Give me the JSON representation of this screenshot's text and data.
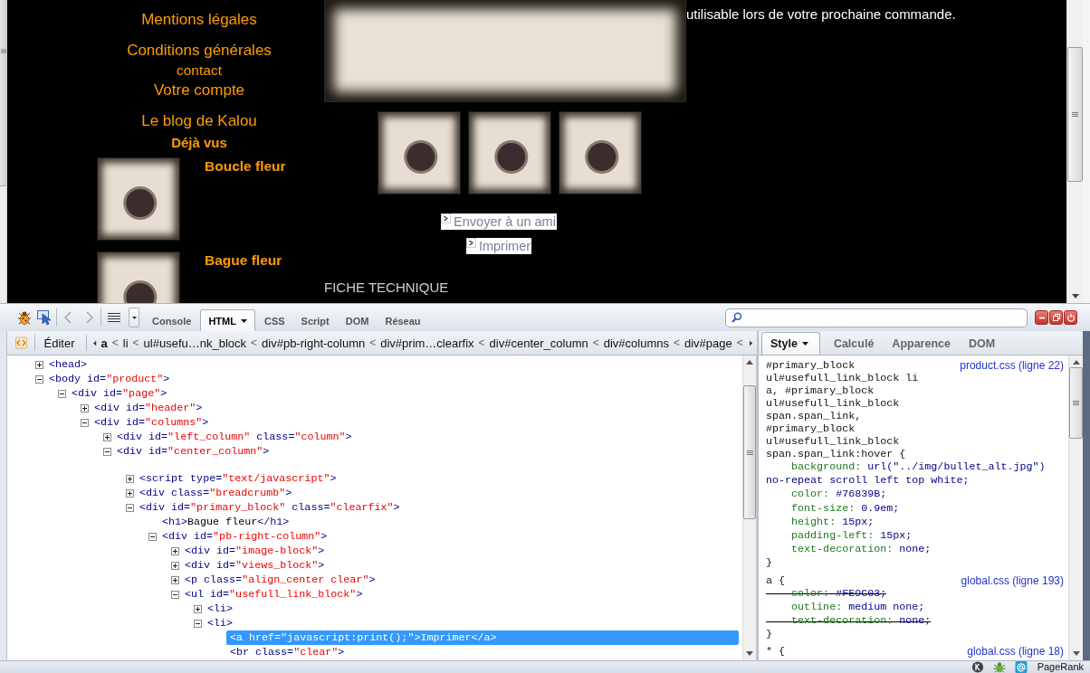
{
  "page": {
    "left_menu": [
      {
        "label": "Mentions légales",
        "kind": "large"
      },
      {
        "label": "Conditions générales",
        "kind": "large"
      },
      {
        "label": "contact",
        "kind": "small"
      },
      {
        "label": "Votre compte",
        "kind": "large"
      },
      {
        "label": "Le blog de Kalou",
        "kind": "large"
      }
    ],
    "viewed": {
      "title": "Déjà vus",
      "products": [
        {
          "name": "Boucle fleur"
        },
        {
          "name": "Bague fleur"
        }
      ]
    },
    "description": "utilisable lors de votre prochaine commande.",
    "links": [
      {
        "label": "Envoyer à un ami"
      },
      {
        "label": "Imprimer"
      }
    ],
    "section_title": "FICHE TECHNIQUE"
  },
  "firebug": {
    "tabs": [
      {
        "label": "Console",
        "selected": false
      },
      {
        "label": "HTML",
        "selected": true
      },
      {
        "label": "CSS",
        "selected": false
      },
      {
        "label": "Script",
        "selected": false
      },
      {
        "label": "DOM",
        "selected": false
      },
      {
        "label": "Réseau",
        "selected": false
      }
    ],
    "edit_button": "Éditer",
    "breadcrumb_separator": "<",
    "breadcrumbs": [
      {
        "label": "a",
        "selected": true
      },
      {
        "label": "li",
        "selected": false
      },
      {
        "label": "ul#usefu…nk_block",
        "selected": false
      },
      {
        "label": "div#pb-right-column",
        "selected": false
      },
      {
        "label": "div#prim…clearfix",
        "selected": false
      },
      {
        "label": "div#center_column",
        "selected": false
      },
      {
        "label": "div#columns",
        "selected": false
      },
      {
        "label": "div#page",
        "selected": false
      }
    ],
    "tree": [
      {
        "kind": "element",
        "source": "<head>",
        "expanded": false,
        "selected": false
      },
      {
        "kind": "element",
        "source": "<body id=\"product\">",
        "expanded": true,
        "selected": false,
        "children": [
          {
            "kind": "element",
            "source": "<div id=\"page\">",
            "expanded": true,
            "selected": false,
            "children": [
              {
                "kind": "element",
                "source": "<div id=\"header\">",
                "expanded": false,
                "selected": false
              },
              {
                "kind": "element",
                "source": "<div id=\"columns\">",
                "expanded": true,
                "selected": false,
                "children": [
                  {
                    "kind": "element",
                    "source": "<div id=\"left_column\" class=\"column\">",
                    "expanded": false,
                    "selected": false
                  },
                  {
                    "kind": "element",
                    "source": "<div id=\"center_column\">",
                    "expanded": true,
                    "selected": false,
                    "children": [
                      {
                        "kind": "whitespace",
                        "selected": false
                      },
                      {
                        "kind": "element",
                        "source": "<script type=\"text/javascript\">",
                        "expanded": false,
                        "selected": false
                      },
                      {
                        "kind": "element",
                        "source": "<div class=\"breadcrumb\">",
                        "expanded": false,
                        "selected": false
                      },
                      {
                        "kind": "element",
                        "source": "<div id=\"primary_block\" class=\"clearfix\">",
                        "expanded": true,
                        "selected": false,
                        "children": [
                          {
                            "kind": "leaf",
                            "source": "<h1>Bague fleur</h1>",
                            "selected": false
                          },
                          {
                            "kind": "element",
                            "source": "<div id=\"pb-right-column\">",
                            "expanded": true,
                            "selected": false,
                            "children": [
                              {
                                "kind": "element",
                                "source": "<div id=\"image-block\">",
                                "expanded": false,
                                "selected": false
                              },
                              {
                                "kind": "element",
                                "source": "<div id=\"views_block\">",
                                "expanded": false,
                                "selected": false
                              },
                              {
                                "kind": "element",
                                "source": "<p class=\"align_center clear\">",
                                "expanded": false,
                                "selected": false
                              },
                              {
                                "kind": "element",
                                "source": "<ul id=\"usefull_link_block\">",
                                "expanded": true,
                                "selected": false,
                                "children": [
                                  {
                                    "kind": "element",
                                    "source": "<li>",
                                    "expanded": false,
                                    "selected": false
                                  },
                                  {
                                    "kind": "element",
                                    "source": "<li>",
                                    "expanded": true,
                                    "selected": false,
                                    "children": [
                                      {
                                        "kind": "leaf",
                                        "source": "<a href=\"javascript:print();\">Imprimer</a>",
                                        "selected": true
                                      },
                                      {
                                        "kind": "leaf",
                                        "source": "<br class=\"clear\">",
                                        "selected": false
                                      }
                                    ]
                                  }
                                ]
                              }
                            ]
                          }
                        ]
                      }
                    ]
                  }
                ]
              }
            ]
          }
        ]
      }
    ],
    "side_tabs": [
      {
        "label": "Style",
        "selected": true
      },
      {
        "label": "Calculé",
        "selected": false
      },
      {
        "label": "Apparence",
        "selected": false
      },
      {
        "label": "DOM",
        "selected": false
      }
    ],
    "rules": [
      {
        "selector": "#primary_block ul#usefull_link_block li a, #primary_block ul#usefull_link_block span.span_link, #primary_block ul#usefull_link_block span.span_link:hover {",
        "source": "product.css (ligne 22)",
        "properties": [
          {
            "text": "background: url(\"../img/bullet_alt.jpg\") no-repeat scroll left top white;",
            "overridden": false
          },
          {
            "text": "color: #76839B;",
            "overridden": false
          },
          {
            "text": "font-size: 0.9em;",
            "overridden": false
          },
          {
            "text": "height: 15px;",
            "overridden": false
          },
          {
            "text": "padding-left: 15px;",
            "overridden": false
          },
          {
            "text": "text-decoration: none;",
            "overridden": false
          }
        ],
        "closing": "}"
      },
      {
        "selector": "a {",
        "source": "global.css (ligne 193)",
        "properties": [
          {
            "text": "color: #FE9C03;",
            "overridden": true
          },
          {
            "text": "outline: medium none;",
            "overridden": false
          },
          {
            "text": "text-decoration: none;",
            "overridden": true
          }
        ],
        "closing": "}"
      },
      {
        "selector": "* {",
        "source": "global.css (ligne 18)"
      }
    ]
  },
  "status_bar": {
    "label": "PageRank"
  }
}
